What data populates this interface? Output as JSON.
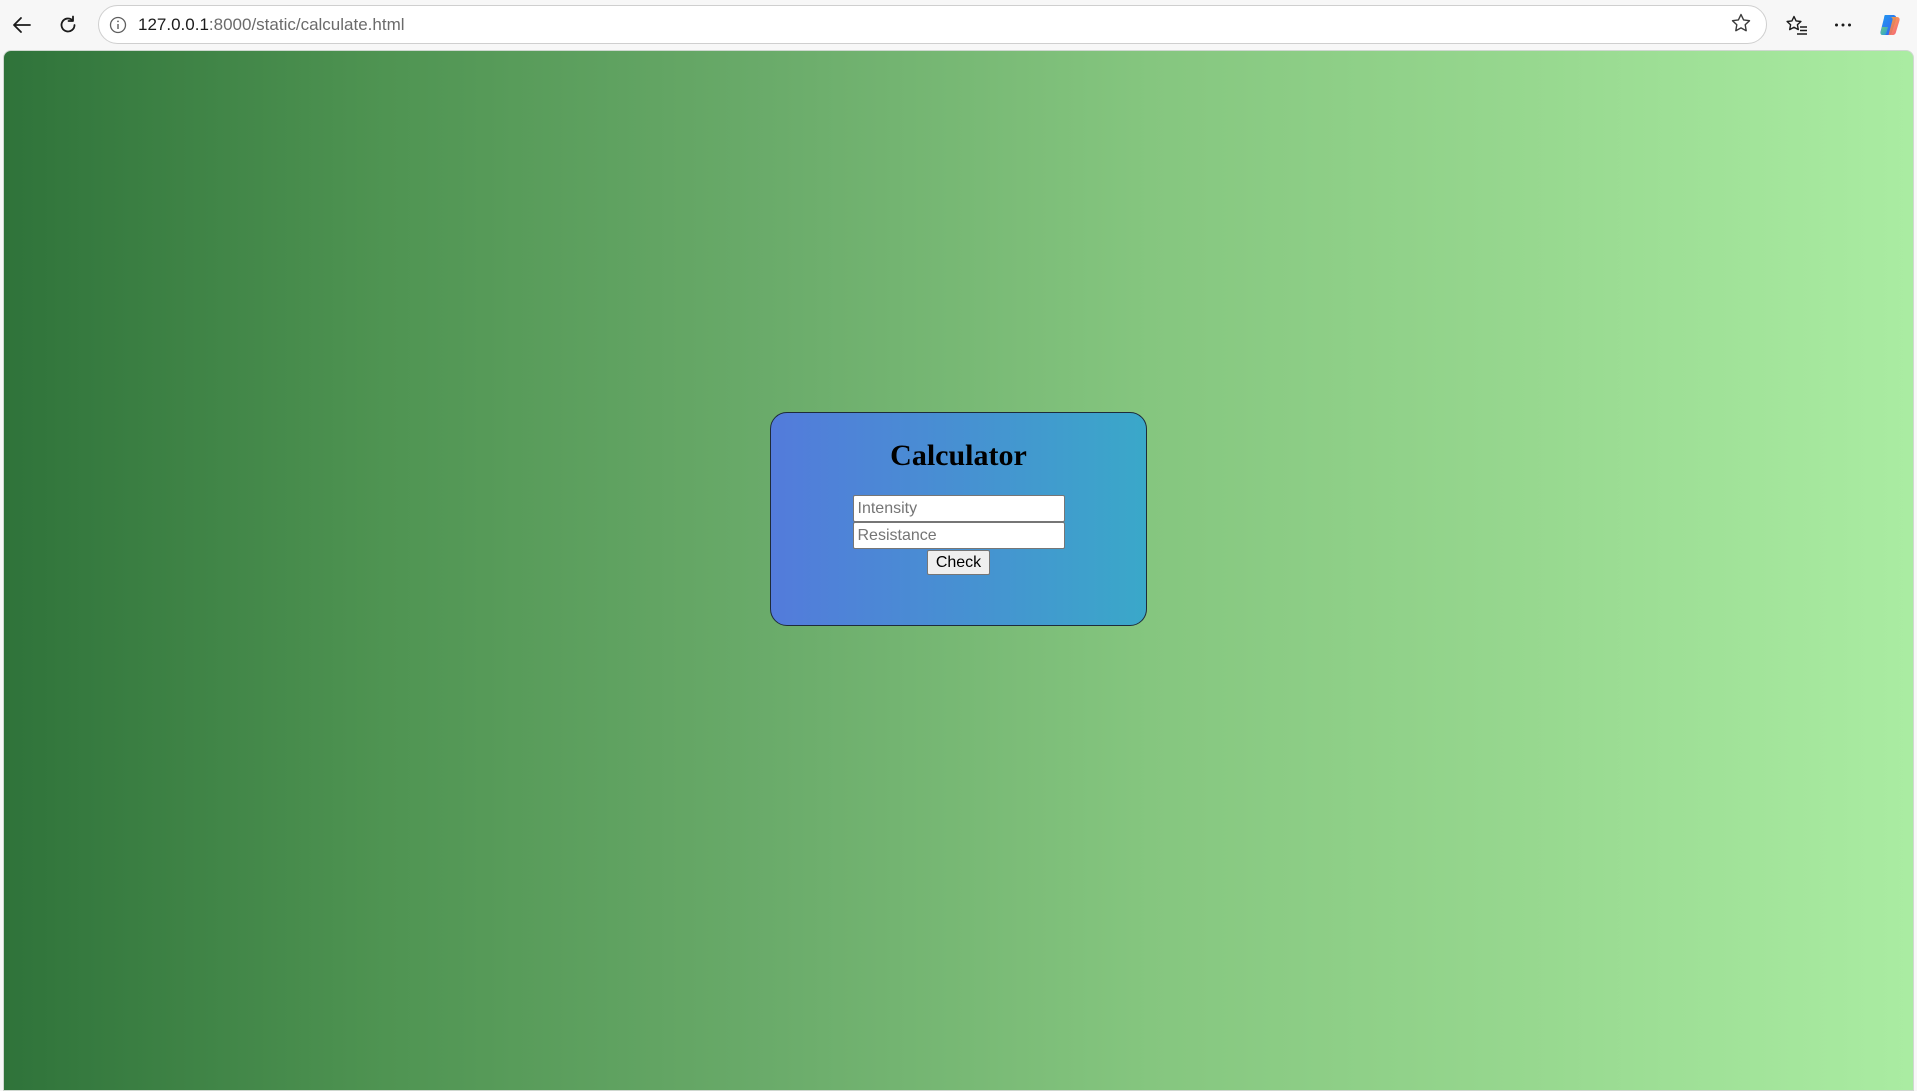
{
  "browser": {
    "url_host": "127.0.0.1",
    "url_path": ":8000/static/calculate.html",
    "icons": {
      "back": "back-arrow-icon",
      "reload": "reload-icon",
      "site_info": "info-icon",
      "favorite": "star-icon",
      "favorites": "favorites-icon",
      "more": "more-icon",
      "copilot": "copilot-icon"
    }
  },
  "page": {
    "background_colors": [
      "#2f733a",
      "#aaeca2"
    ],
    "calculator": {
      "title": "Calculator",
      "intensity_placeholder": "Intensity",
      "intensity_value": "",
      "resistance_placeholder": "Resistance",
      "resistance_value": "",
      "check_label": "Check",
      "card_colors": [
        "#537bdb",
        "#3aa8c9"
      ]
    }
  }
}
